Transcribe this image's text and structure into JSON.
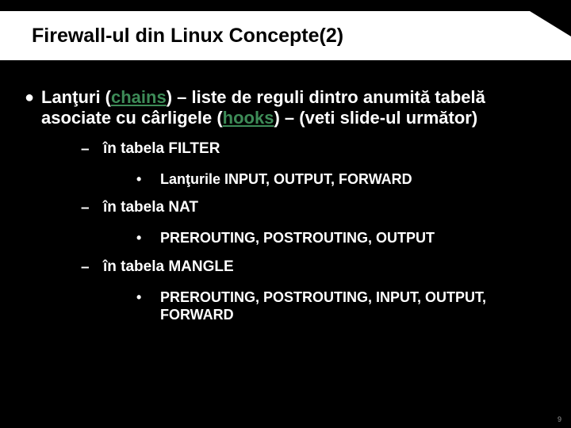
{
  "title": "Firewall-ul din Linux Concepte(2)",
  "main_pre": "Lanţuri (",
  "main_link1": "chains",
  "main_mid": ") – liste de reguli dintro anumită tabelă asociate cu cârligele (",
  "main_link2": "hooks",
  "main_post": ") – (veti slide-ul următor)",
  "l2a": "în tabela FILTER",
  "l3a": "Lanţurile INPUT, OUTPUT, FORWARD",
  "l2b": "în tabela NAT",
  "l3b": "PREROUTING, POSTROUTING, OUTPUT",
  "l2c": "în tabela MANGLE",
  "l3c": "PREROUTING, POSTROUTING, INPUT, OUTPUT, FORWARD",
  "page_num": "9"
}
